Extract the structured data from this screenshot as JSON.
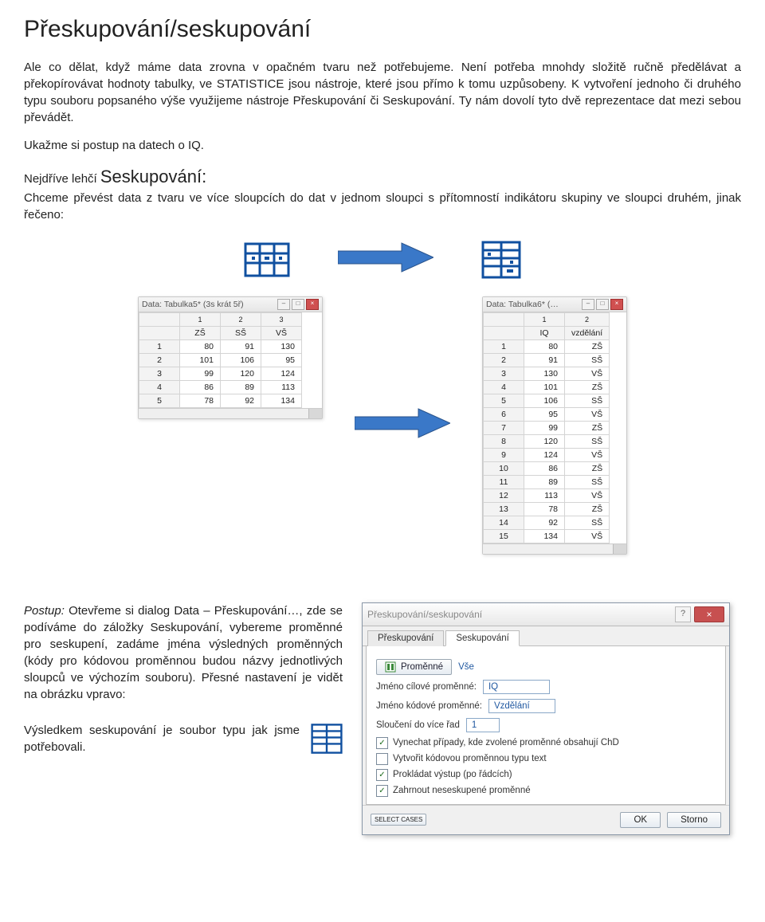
{
  "heading": "Přeskupování/seskupování",
  "intro": "Ale co dělat, když máme data zrovna v opačném tvaru než potřebujeme. Není potřeba mnohdy složitě ručně předělávat a překopírovávat hodnoty tabulky, ve STATISTICE jsou nástroje, které jsou přímo k tomu uzpůsobeny. K vytvoření jednoho či druhého typu souboru popsaného výše využijeme nástroje Přeskupování či Seskupování. Ty nám dovolí tyto dvě reprezentace dat mezi sebou převádět.",
  "demo_line": "Ukažme si postup na datech o IQ.",
  "seskup_prefix": "Nejdříve lehčí ",
  "seskup_label": "Seskupování:",
  "seskup_para": "Chceme převést data z tvaru ve více sloupcích do dat v jednom sloupci s přítomností indikátoru skupiny ve sloupci druhém, jinak řečeno:",
  "tableA": {
    "title": "Data: Tabulka5* (3s krát 5ř)",
    "col_nums": [
      "1",
      "2",
      "3"
    ],
    "col_names": [
      "ZŠ",
      "SŠ",
      "VŠ"
    ],
    "rows": [
      [
        "1",
        "80",
        "91",
        "130"
      ],
      [
        "2",
        "101",
        "106",
        "95"
      ],
      [
        "3",
        "99",
        "120",
        "124"
      ],
      [
        "4",
        "86",
        "89",
        "113"
      ],
      [
        "5",
        "78",
        "92",
        "134"
      ]
    ]
  },
  "tableB": {
    "title": "Data: Tabulka6* (…",
    "col_nums": [
      "1",
      "2"
    ],
    "col_names": [
      "IQ",
      "vzdělání"
    ],
    "rows": [
      [
        "1",
        "80",
        "ZŠ"
      ],
      [
        "2",
        "91",
        "SŠ"
      ],
      [
        "3",
        "130",
        "VŠ"
      ],
      [
        "4",
        "101",
        "ZŠ"
      ],
      [
        "5",
        "106",
        "SŠ"
      ],
      [
        "6",
        "95",
        "VŠ"
      ],
      [
        "7",
        "99",
        "ZŠ"
      ],
      [
        "8",
        "120",
        "SŠ"
      ],
      [
        "9",
        "124",
        "VŠ"
      ],
      [
        "10",
        "86",
        "ZŠ"
      ],
      [
        "11",
        "89",
        "SŠ"
      ],
      [
        "12",
        "113",
        "VŠ"
      ],
      [
        "13",
        "78",
        "ZŠ"
      ],
      [
        "14",
        "92",
        "SŠ"
      ],
      [
        "15",
        "134",
        "VŠ"
      ]
    ]
  },
  "postup": {
    "prefix": "Postup:",
    "text": "Otevřeme si dialog Data – Přeskupování…, zde se podíváme do záložky Seskupování, vybereme proměnné pro seskupení, zadáme jména výsledných proměnných (kódy pro kódovou proměnnou budou názvy jednotlivých sloupců ve výchozím souboru). Přesné nastavení je vidět na obrázku vpravo:"
  },
  "result_line": "Výsledkem seskupování je soubor typu jak jsme potřebovali.",
  "dialog": {
    "title": "Přeskupování/seskupování",
    "tab1": "Přeskupování",
    "tab2": "Seskupování",
    "btn_promenne": "Proměnné",
    "vse": "Vše",
    "lbl_cilove": "Jméno cílové proměnné:",
    "val_cilove": "IQ",
    "lbl_kodove": "Jméno kódové proměnné:",
    "val_kodove": "Vzdělání",
    "lbl_slouceni": "Sloučení do více řad",
    "val_slouceni": "1",
    "chk1": "Vynechat případy, kde zvolené proměnné obsahují ChD",
    "chk2": "Vytvořit kódovou proměnnou typu text",
    "chk3": "Prokládat výstup (po řádcích)",
    "chk4": "Zahrnout neseskupené proměnné",
    "select_cases": "SELECT CASES",
    "ok": "OK",
    "storno": "Storno"
  }
}
